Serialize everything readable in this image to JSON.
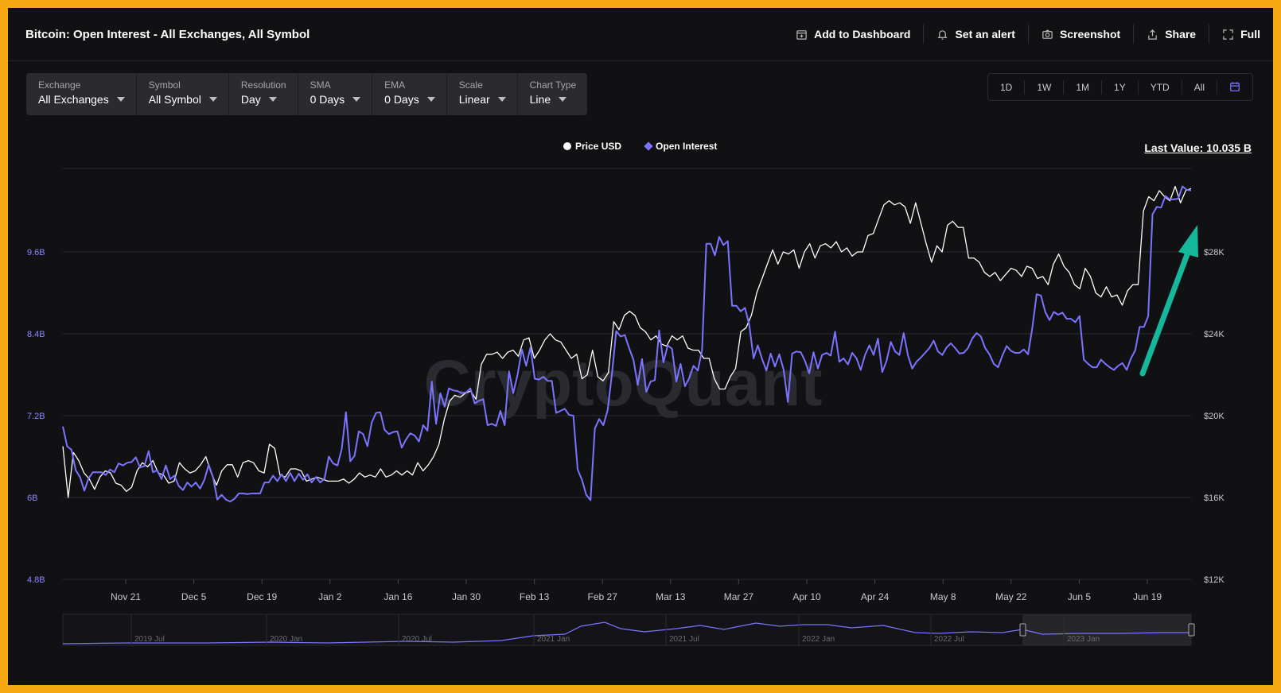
{
  "header": {
    "title": "Bitcoin: Open Interest - All Exchanges, All Symbol",
    "actions": [
      {
        "label": "Add to Dashboard",
        "icon": "dashboard-add-icon"
      },
      {
        "label": "Set an alert",
        "icon": "bell-icon"
      },
      {
        "label": "Screenshot",
        "icon": "camera-icon"
      },
      {
        "label": "Share",
        "icon": "share-icon"
      },
      {
        "label": "Full",
        "icon": "fullscreen-icon"
      }
    ]
  },
  "controls": [
    {
      "label": "Exchange",
      "value": "All Exchanges"
    },
    {
      "label": "Symbol",
      "value": "All Symbol"
    },
    {
      "label": "Resolution",
      "value": "Day"
    },
    {
      "label": "SMA",
      "value": "0 Days"
    },
    {
      "label": "EMA",
      "value": "0 Days"
    },
    {
      "label": "Scale",
      "value": "Linear"
    },
    {
      "label": "Chart Type",
      "value": "Line"
    }
  ],
  "ranges": [
    "1D",
    "1W",
    "1M",
    "1Y",
    "YTD",
    "All"
  ],
  "last_value": "Last Value: 10.035 B",
  "watermark": "CryptoQuant",
  "colors": {
    "background": "#111114",
    "frame": "#f5a80f",
    "open_interest": "#7a74ff",
    "price": "#ffffff",
    "arrow": "#16b89c"
  },
  "chart_data": {
    "type": "line",
    "x_ticks": [
      "Nov 21",
      "Dec 5",
      "Dec 19",
      "Jan 2",
      "Jan 16",
      "Jan 30",
      "Feb 13",
      "Feb 27",
      "Mar 13",
      "Mar 27",
      "Apr 10",
      "Apr 24",
      "May 8",
      "May 22",
      "Jun 5",
      "Jun 19"
    ],
    "y_left": {
      "ticks": [
        "4.8B",
        "6B",
        "7.2B",
        "8.4B",
        "9.6B"
      ],
      "range_billion": [
        4.8,
        10.5
      ]
    },
    "y_right": {
      "ticks": [
        "$12K",
        "$16K",
        "$20K",
        "$24K",
        "$28K"
      ],
      "range_usd": [
        12000,
        34000
      ]
    },
    "legend_position": "top-center",
    "grid": true,
    "series": [
      {
        "name": "Price USD",
        "axis": "right",
        "values": [
          18500,
          16000,
          18200,
          17800,
          17200,
          16900,
          16400,
          17000,
          17300,
          17200,
          16700,
          16600,
          16300,
          16500,
          17300,
          17700,
          17500,
          17800,
          17200,
          17100,
          16700,
          16800,
          17700,
          17400,
          17200,
          17300,
          17600,
          18000,
          17200,
          16600,
          17300,
          17600,
          17600,
          17000,
          17700,
          17800,
          17700,
          17300,
          17200,
          18600,
          18400,
          17100,
          17000,
          17400,
          17400,
          17300,
          16800,
          16900,
          17000,
          16900,
          16800,
          16800,
          16800,
          16900,
          16700,
          16900,
          17200,
          17000,
          17100,
          17000,
          17400,
          17000,
          17100,
          17300,
          17100,
          17300,
          17100,
          17700,
          17300,
          17600,
          18000,
          18600,
          19800,
          20700,
          21000,
          20900,
          21100,
          21200,
          20800,
          22500,
          23000,
          23000,
          23100,
          22800,
          23100,
          23200,
          22900,
          23700,
          23800,
          22800,
          23200,
          23700,
          24000,
          23700,
          23600,
          23200,
          22800,
          23000,
          21800,
          22000,
          23200,
          21900,
          21700,
          22100,
          24600,
          24200,
          24900,
          25100,
          24900,
          24300,
          24100,
          23700,
          23900,
          23500,
          23400,
          23900,
          23700,
          23900,
          23300,
          23200,
          23200,
          22800,
          22800,
          21800,
          21300,
          21300,
          21900,
          22300,
          24100,
          24300,
          24900,
          26000,
          26700,
          27400,
          28100,
          27400,
          28000,
          27900,
          28100,
          27200,
          28000,
          28400,
          27700,
          28300,
          28400,
          28200,
          28500,
          28000,
          28200,
          27800,
          28000,
          28000,
          28800,
          28900,
          29600,
          30300,
          30500,
          30300,
          30400,
          30200,
          29400,
          30400,
          29400,
          28400,
          27500,
          28300,
          28000,
          29300,
          29500,
          29200,
          29200,
          27700,
          27700,
          27500,
          27000,
          26800,
          27000,
          26600,
          26900,
          27200,
          27100,
          26800,
          27300,
          27200,
          26700,
          26800,
          26400,
          27400,
          27900,
          27300,
          27000,
          26400,
          26200,
          27200,
          26800,
          26000,
          25800,
          26300,
          25800,
          25900,
          25400,
          26100,
          26400,
          26400,
          30000,
          30700,
          30500,
          31000,
          30700,
          30500,
          31200,
          30400,
          31000,
          31100
        ],
        "color": "#ffffff"
      },
      {
        "name": "Open Interest",
        "axis": "left",
        "values": [
          7.04,
          6.75,
          6.7,
          6.4,
          6.3,
          6.1,
          6.28,
          6.37,
          6.37,
          6.37,
          6.33,
          6.41,
          6.37,
          6.5,
          6.47,
          6.51,
          6.52,
          6.59,
          6.44,
          6.46,
          6.68,
          6.37,
          6.4,
          6.27,
          6.47,
          6.27,
          6.32,
          6.17,
          6.11,
          6.22,
          6.16,
          6.22,
          6.13,
          6.26,
          6.48,
          6.3,
          5.97,
          6.04,
          5.97,
          5.94,
          5.98,
          6.06,
          6.06,
          6.05,
          6.06,
          6.06,
          6.06,
          6.22,
          6.22,
          6.32,
          6.24,
          6.34,
          6.24,
          6.36,
          6.24,
          6.35,
          6.26,
          6.34,
          6.22,
          6.3,
          6.22,
          6.28,
          6.6,
          6.5,
          6.47,
          6.71,
          7.25,
          6.53,
          6.61,
          6.97,
          6.93,
          6.75,
          7.1,
          7.24,
          7.25,
          6.99,
          6.93,
          6.96,
          6.97,
          6.73,
          6.85,
          6.94,
          6.91,
          6.82,
          7.06,
          6.98,
          7.7,
          7.08,
          7.53,
          7.33,
          7.6,
          7.57,
          7.56,
          7.53,
          7.54,
          7.6,
          7.38,
          7.42,
          7.44,
          7.06,
          7.08,
          7.05,
          7.27,
          7.06,
          7.85,
          7.53,
          7.8,
          8.17,
          7.93,
          8.2,
          7.74,
          7.73,
          7.77,
          7.71,
          7.71,
          7.24,
          7.27,
          7.3,
          7.21,
          7.2,
          6.41,
          6.26,
          6.04,
          5.96,
          7.01,
          7.15,
          7.06,
          7.28,
          7.81,
          8.44,
          8.36,
          8.38,
          8.19,
          8.02,
          7.65,
          8.03,
          7.55,
          7.7,
          7.72,
          8.45,
          7.98,
          8.23,
          8.18,
          7.7,
          7.96,
          7.63,
          7.75,
          7.93,
          7.86,
          8.16,
          9.72,
          9.72,
          9.55,
          9.82,
          9.7,
          9.76,
          8.81,
          8.81,
          8.73,
          8.78,
          8.53,
          8.04,
          8.23,
          8.03,
          7.86,
          8.11,
          7.92,
          8.1,
          7.88,
          7.4,
          8.11,
          8.14,
          8.13,
          8.0,
          7.82,
          8.13,
          7.89,
          8.09,
          8.12,
          8.08,
          8.43,
          7.99,
          8.04,
          7.95,
          8.12,
          8.04,
          7.87,
          8.09,
          8.23,
          8.09,
          8.33,
          7.84,
          8.0,
          8.28,
          8.14,
          8.09,
          8.41,
          8.08,
          7.89,
          7.99,
          8.05,
          8.12,
          8.19,
          8.3,
          8.14,
          8.09,
          8.2,
          8.26,
          8.19,
          8.11,
          8.12,
          8.19,
          8.33,
          8.41,
          8.36,
          8.19,
          8.1,
          7.96,
          7.91,
          8.08,
          8.22,
          8.15,
          8.12,
          8.12,
          8.17,
          8.1,
          8.49,
          8.98,
          8.96,
          8.72,
          8.6,
          8.72,
          8.68,
          8.71,
          8.62,
          8.62,
          8.57,
          8.66,
          8.02,
          7.96,
          7.91,
          7.91,
          8.02,
          7.96,
          7.91,
          7.87,
          7.93,
          7.97,
          7.87,
          8.04,
          8.16,
          8.5,
          8.5,
          8.66,
          10.15,
          10.26,
          10.25,
          10.42,
          10.37,
          10.37,
          10.38,
          10.56,
          10.51,
          10.5
        ],
        "color": "#7a74ff"
      }
    ]
  },
  "navigator": {
    "labels": [
      "2019 Jul",
      "2020 Jan",
      "2020 Jul",
      "2021 Jan",
      "2021 Jul",
      "2022 Jan",
      "2022 Jul",
      "2023 Jan"
    ]
  }
}
